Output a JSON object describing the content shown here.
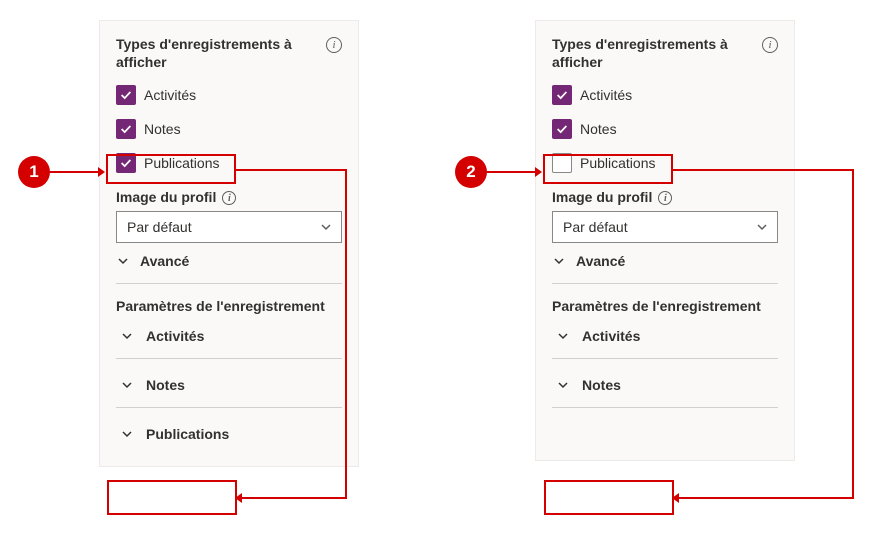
{
  "annotations": {
    "badge1": "1",
    "badge2": "2"
  },
  "colors": {
    "accent": "#742774",
    "alert": "#d40000"
  },
  "panelLeft": {
    "title": "Types d'enregistrements à afficher",
    "checkboxes": {
      "activities": {
        "label": "Activités",
        "checked": true
      },
      "notes": {
        "label": "Notes",
        "checked": true
      },
      "publications": {
        "label": "Publications",
        "checked": true
      }
    },
    "profileImage": {
      "label": "Image du profil",
      "value": "Par défaut"
    },
    "advanced": {
      "label": "Avancé"
    },
    "recordSettings": {
      "title": "Paramètres de l'enregistrement",
      "items": {
        "activities": "Activités",
        "notes": "Notes",
        "publications": "Publications"
      }
    }
  },
  "panelRight": {
    "title": "Types d'enregistrements à afficher",
    "checkboxes": {
      "activities": {
        "label": "Activités",
        "checked": true
      },
      "notes": {
        "label": "Notes",
        "checked": true
      },
      "publications": {
        "label": "Publications",
        "checked": false
      }
    },
    "profileImage": {
      "label": "Image du profil",
      "value": "Par défaut"
    },
    "advanced": {
      "label": "Avancé"
    },
    "recordSettings": {
      "title": "Paramètres de l'enregistrement",
      "items": {
        "activities": "Activités",
        "notes": "Notes"
      }
    }
  }
}
